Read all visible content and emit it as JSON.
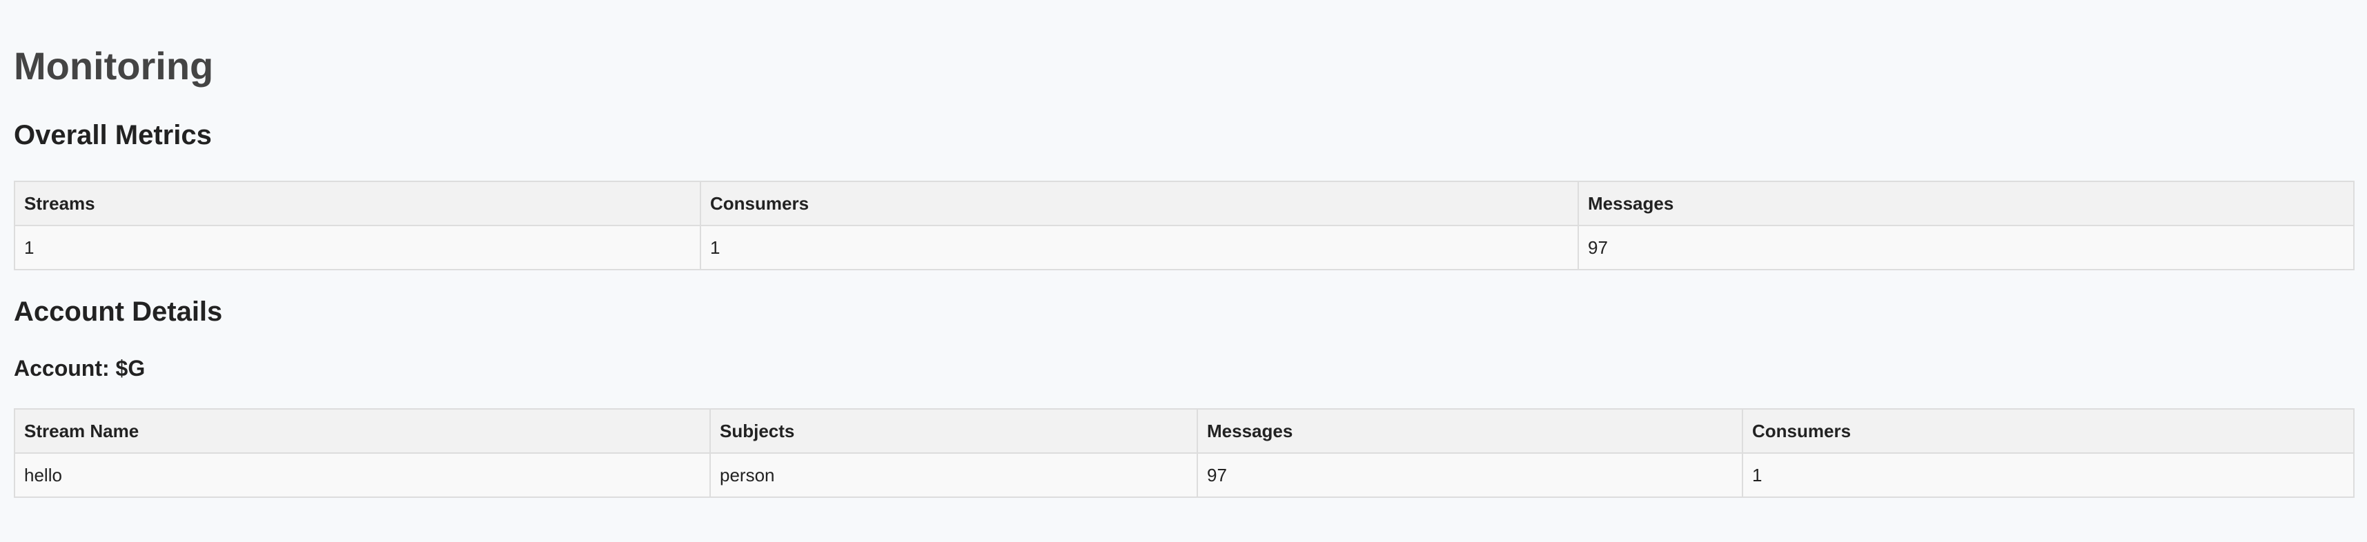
{
  "page": {
    "title": "Monitoring"
  },
  "overall": {
    "title": "Overall Metrics",
    "headers": [
      "Streams",
      "Consumers",
      "Messages"
    ],
    "row": [
      "1",
      "1",
      "97"
    ]
  },
  "account": {
    "title": "Account Details",
    "subtitle": "Account: $G",
    "headers": [
      "Stream Name",
      "Subjects",
      "Messages",
      "Consumers"
    ],
    "rows": [
      [
        "hello",
        "person",
        "97",
        "1"
      ]
    ]
  }
}
